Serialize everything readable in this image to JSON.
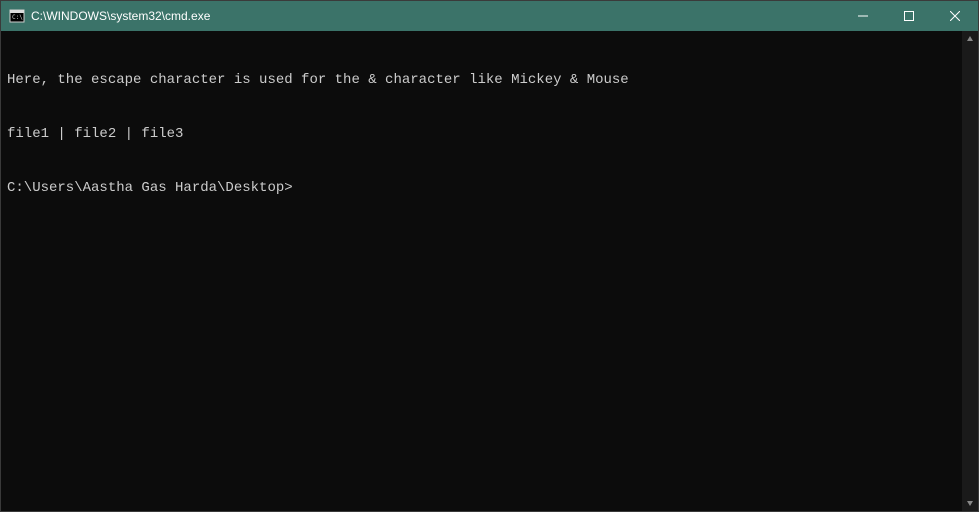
{
  "window": {
    "title": "C:\\WINDOWS\\system32\\cmd.exe"
  },
  "terminal": {
    "lines": [
      "Here, the escape character is used for the & character like Mickey & Mouse",
      "file1 | file2 | file3"
    ],
    "prompt": "C:\\Users\\Aastha Gas Harda\\Desktop>"
  }
}
